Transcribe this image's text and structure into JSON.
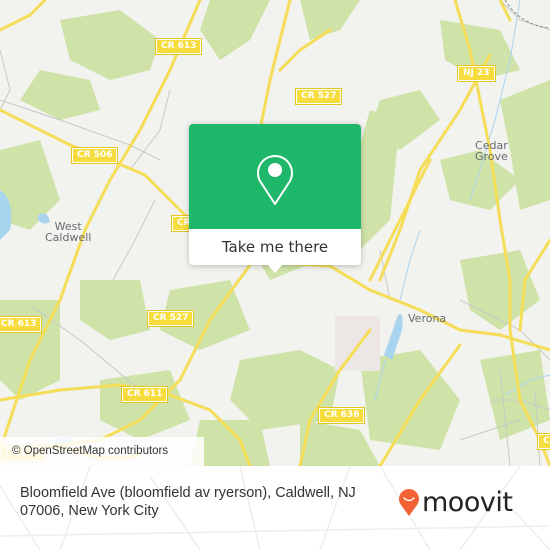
{
  "map": {
    "colors": {
      "background": "#f2f2ee",
      "park": "#cfe3a8",
      "road_major": "#f5dd57",
      "road_minor": "#c8c8c8",
      "water": "#a8d4ef",
      "brand_green": "#1fb86a",
      "moovit_orange": "#f26234"
    },
    "road_shields": [
      {
        "id": "cr613-top",
        "label": "CR 613"
      },
      {
        "id": "cr527-top",
        "label": "CR 527"
      },
      {
        "id": "nj23",
        "label": "NJ 23"
      },
      {
        "id": "cr506",
        "label": "CR 506"
      },
      {
        "id": "cr-partial",
        "label": "CR"
      },
      {
        "id": "cr613-left",
        "label": "CR 613"
      },
      {
        "id": "cr527-mid",
        "label": "CR 527"
      },
      {
        "id": "cr611",
        "label": "CR 611"
      },
      {
        "id": "cr636",
        "label": "CR 636"
      },
      {
        "id": "cr527-bottom",
        "label": "CR 527"
      },
      {
        "id": "cr-right",
        "label": "C"
      }
    ],
    "places": [
      {
        "id": "west-caldwell",
        "label": "West\nCaldwell"
      },
      {
        "id": "cedar-grove",
        "label": "Cedar\nGrove"
      },
      {
        "id": "verona",
        "label": "Verona"
      }
    ],
    "attribution": "© OpenStreetMap contributors"
  },
  "popup": {
    "icon": "map-pin-icon",
    "button_label": "Take me there"
  },
  "footer": {
    "address": "Bloomfield Ave (bloomfield av ryerson), Caldwell, NJ 07006, New York City",
    "logo_text": "moovit",
    "logo_icon": "moovit-smiley-pin-icon"
  }
}
